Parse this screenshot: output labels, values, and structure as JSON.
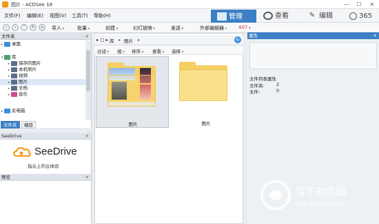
{
  "window": {
    "title": "图片 - ACDSee 18",
    "minimize": "—",
    "maximize": "☐",
    "close": "✕"
  },
  "menu": {
    "items": [
      "文件(F)",
      "编辑(E)",
      "视图(V)",
      "工具(T)",
      "帮助(H)"
    ]
  },
  "modes": [
    {
      "label": "管理",
      "icon": "manage-icon"
    },
    {
      "label": "查看",
      "icon": "view-icon"
    },
    {
      "label": "编辑",
      "icon": "edit-icon"
    },
    {
      "label": "365",
      "icon": "365-icon"
    }
  ],
  "toolbar": {
    "items": [
      "导入",
      "批量",
      "创建",
      "幻灯放映",
      "发送",
      "外部编辑器",
      "407"
    ]
  },
  "folders_panel": {
    "title": "文件夹",
    "tree": [
      {
        "label": "桌面",
        "indent": 0,
        "icon_color": "#3b8fdc",
        "arrow": "▸"
      },
      {
        "label": "库",
        "indent": 0,
        "icon_color": "#4aa36d",
        "arrow": "▾"
      },
      {
        "label": "保存的图片",
        "indent": 1,
        "icon_color": "#5b6f88",
        "arrow": "▸"
      },
      {
        "label": "本机照片",
        "indent": 1,
        "icon_color": "#5b6f88",
        "arrow": "▸"
      },
      {
        "label": "视频",
        "indent": 1,
        "icon_color": "#5b6f88",
        "arrow": "▸"
      },
      {
        "label": "图片",
        "indent": 1,
        "icon_color": "#5b6f88",
        "arrow": "▸"
      },
      {
        "label": "文档",
        "indent": 1,
        "icon_color": "#5b6f88",
        "arrow": "▸"
      },
      {
        "label": "音乐",
        "indent": 1,
        "icon_color": "#d04b8a",
        "arrow": "▸"
      },
      {
        "label": "此电脑",
        "indent": 0,
        "icon_color": "#3b8fdc",
        "arrow": "▸"
      }
    ],
    "tabs": [
      "文件夹",
      "编目"
    ]
  },
  "seedrive": {
    "title": "SeeDrive",
    "brand": "SeeDrive",
    "tagline": "指尖上的云体验"
  },
  "preview_panel": {
    "title": "预览"
  },
  "content": {
    "breadcrumb": [
      "库",
      "图片"
    ],
    "filters": [
      "过滤",
      "组",
      "排序",
      "查看",
      "选择"
    ],
    "items": [
      {
        "label": "图片"
      },
      {
        "label": "图片"
      }
    ]
  },
  "properties": {
    "title": "属性",
    "section": "文件列表属性",
    "rows": [
      {
        "key": "文件夹:",
        "value": "2"
      },
      {
        "key": "文件:",
        "value": "0"
      }
    ]
  },
  "watermark": {
    "line1": "当下软件园",
    "line2": "www.downxia.com"
  },
  "colors": {
    "accent": "#3b7fc4",
    "folder": "#f4cf62",
    "brand_orange": "#f29a1b"
  }
}
